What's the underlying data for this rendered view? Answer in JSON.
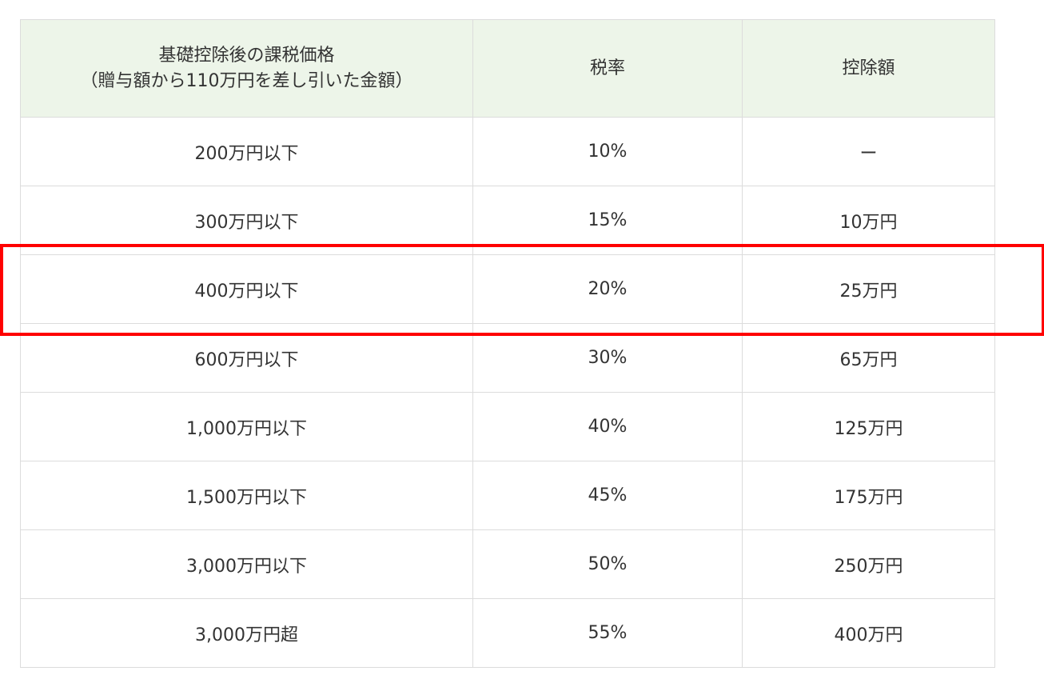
{
  "table": {
    "headers": {
      "taxable_amount_line1": "基礎控除後の課税価格",
      "taxable_amount_line2": "（贈与額から110万円を差し引いた金額）",
      "rate": "税率",
      "deduction": "控除額"
    },
    "rows": [
      {
        "amount": "200万円以下",
        "rate": "10%",
        "deduction": "ー"
      },
      {
        "amount": "300万円以下",
        "rate": "15%",
        "deduction": "10万円"
      },
      {
        "amount": "400万円以下",
        "rate": "20%",
        "deduction": "25万円"
      },
      {
        "amount": "600万円以下",
        "rate": "30%",
        "deduction": "65万円"
      },
      {
        "amount": "1,000万円以下",
        "rate": "40%",
        "deduction": "125万円"
      },
      {
        "amount": "1,500万円以下",
        "rate": "45%",
        "deduction": "175万円"
      },
      {
        "amount": "3,000万円以下",
        "rate": "50%",
        "deduction": "250万円"
      },
      {
        "amount": "3,000万円超",
        "rate": "55%",
        "deduction": "400万円"
      }
    ],
    "highlighted_row": 2
  },
  "colors": {
    "header_bg": "#edf5e9",
    "border": "#dcdcdc",
    "highlight": "#ff0000",
    "text": "#333333"
  }
}
